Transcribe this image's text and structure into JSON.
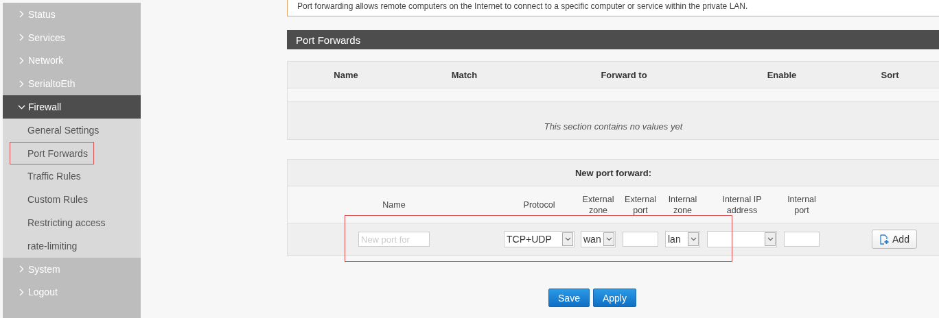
{
  "sidebar": {
    "items": [
      {
        "label": "Status",
        "kind": "menu",
        "expanded": false
      },
      {
        "label": "Services",
        "kind": "menu",
        "expanded": false
      },
      {
        "label": "Network",
        "kind": "menu",
        "expanded": false
      },
      {
        "label": "SerialtoEth",
        "kind": "menu",
        "expanded": false
      },
      {
        "label": "Firewall",
        "kind": "menu",
        "expanded": true,
        "children": [
          {
            "label": "General Settings",
            "selected": false
          },
          {
            "label": "Port Forwards",
            "selected": true
          },
          {
            "label": "Traffic Rules",
            "selected": false
          },
          {
            "label": "Custom Rules",
            "selected": false
          },
          {
            "label": "Restricting access",
            "selected": false
          },
          {
            "label": "rate-limiting",
            "selected": false
          }
        ]
      },
      {
        "label": "System",
        "kind": "menu",
        "expanded": false
      },
      {
        "label": "Logout",
        "kind": "menu",
        "expanded": false
      }
    ]
  },
  "description": "Port forwarding allows remote computers on the Internet to connect to a specific computer or service within the private LAN.",
  "section": {
    "title": "Port Forwards",
    "columns": [
      "Name",
      "Match",
      "Forward to",
      "Enable",
      "Sort"
    ],
    "empty_text": "This section contains no values yet"
  },
  "new_form": {
    "title": "New port forward:",
    "columns": [
      "Name",
      "Protocol",
      "External zone",
      "External port",
      "Internal zone",
      "Internal IP address",
      "Internal port"
    ],
    "fields": [
      {
        "kind": "text",
        "placeholder": "New port for"
      },
      {
        "kind": "select",
        "value": "TCP+UDP"
      },
      {
        "kind": "select",
        "value": "wan"
      },
      {
        "kind": "text"
      },
      {
        "kind": "select",
        "value": "lan"
      },
      {
        "kind": "select"
      },
      {
        "kind": "text"
      }
    ],
    "add_button": "Add"
  },
  "buttons": [
    "Save",
    "Apply"
  ]
}
